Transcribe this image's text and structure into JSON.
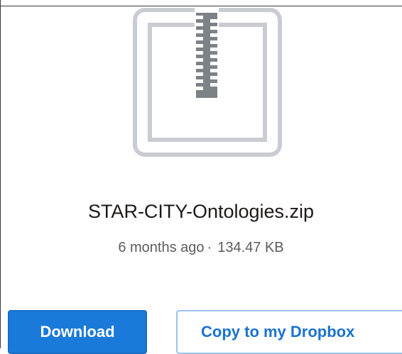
{
  "file": {
    "name": "STAR-CITY-Ontologies.zip",
    "modified": "6 months ago",
    "separator": "·",
    "size": "134.47 KB",
    "icon": "zip-file-icon"
  },
  "actions": {
    "download_label": "Download",
    "copy_label": "Copy to my Dropbox"
  },
  "colors": {
    "primary": "#1a7ad9",
    "primary_text": "#ffffff",
    "secondary_text": "#1a73d0",
    "secondary_border": "#9cc3ec",
    "icon_gray": "#c9cdd2",
    "zipper_gray": "#7d8286"
  }
}
